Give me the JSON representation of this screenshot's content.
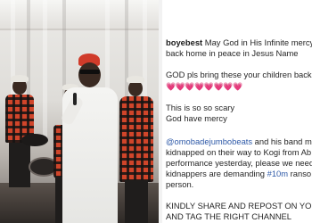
{
  "post": {
    "username": "boyebest",
    "line1": "May God in His Infinite mercy",
    "line2": "back home in peace in Jesus Name",
    "line3": "GOD pls bring these your children back h",
    "hearts": "💗💗💗💗💗💗💗💗",
    "line4": "This is so so scary",
    "line5": "God have mercy",
    "mention": "@omobadejumbobeats",
    "line6_rest": " and his band m",
    "line7": "kidnapped on their way to Kogi from Ab",
    "line8": "performance  yesterday, please we need",
    "line9": "kidnappers are demanding ",
    "hashtag": "#10m",
    "line9_rest": " ranso",
    "line10": "person.",
    "line11": "KINDLY SHARE AND REPOST ON YOUR",
    "line12": "AND TAG THE RIGHT CHANNEL"
  },
  "colors": {
    "accent_link": "#2f5aa8",
    "heart": "#e8457d",
    "plaid_red": "#d0452a"
  }
}
